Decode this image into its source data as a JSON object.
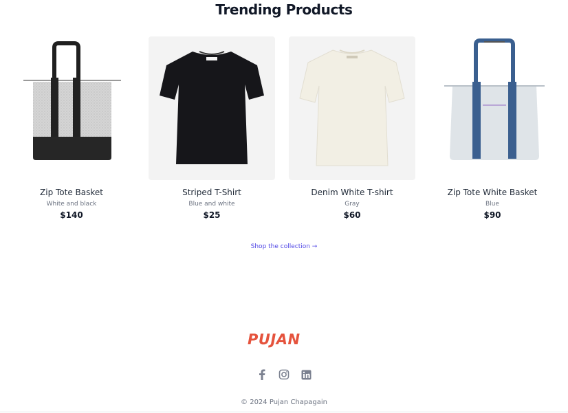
{
  "section": {
    "title": "Trending Products"
  },
  "products": [
    {
      "name": "Zip Tote Basket",
      "color": "White and black",
      "price": "$140"
    },
    {
      "name": "Striped T-Shirt",
      "color": "Blue and white",
      "price": "$25"
    },
    {
      "name": "Denim White T-shirt",
      "color": "Gray",
      "price": "$60"
    },
    {
      "name": "Zip Tote White Basket",
      "color": "Blue",
      "price": "$90"
    }
  ],
  "shop_link": "Shop the collection →",
  "footer": {
    "logo_text": "PUJAN",
    "social_icons": [
      "facebook-icon",
      "instagram-icon",
      "linkedin-icon"
    ],
    "copyright": "© 2024 Pujan Chapagain"
  },
  "colors": {
    "brand": "#e5533d",
    "link": "#4f46e5",
    "muted": "#6b7280"
  }
}
